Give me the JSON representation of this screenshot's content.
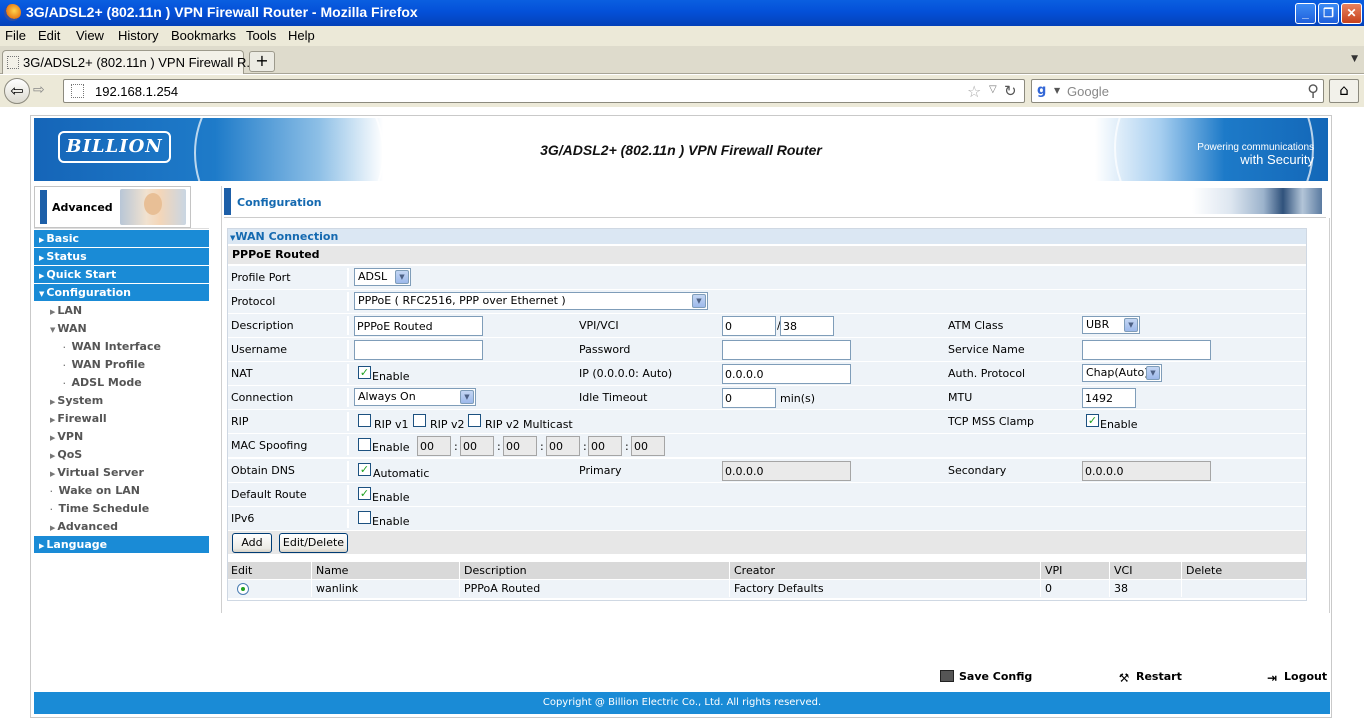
{
  "window": {
    "title": "3G/ADSL2+ (802.11n ) VPN Firewall Router - Mozilla Firefox"
  },
  "menu": [
    "File",
    "Edit",
    "View",
    "History",
    "Bookmarks",
    "Tools",
    "Help"
  ],
  "tab": {
    "label": "3G/ADSL2+ (802.11n ) VPN Firewall R..."
  },
  "nav": {
    "url": "192.168.1.254",
    "search_placeholder": "Google"
  },
  "banner": {
    "logo": "BILLION",
    "title": "3G/ADSL2+ (802.11n ) VPN Firewall Router",
    "slogan_line1": "Powering communications",
    "slogan_line2": "with Security"
  },
  "sidebar": {
    "mode": "Advanced",
    "items": [
      "Basic",
      "Status",
      "Quick Start",
      "Configuration",
      "LAN",
      "WAN",
      "WAN Interface",
      "WAN Profile",
      "ADSL Mode",
      "System",
      "Firewall",
      "VPN",
      "QoS",
      "Virtual Server",
      "Wake on LAN",
      "Time Schedule",
      "Advanced",
      "Language"
    ]
  },
  "content": {
    "header": "Configuration",
    "section": "WAN Connection",
    "subsection": "PPPoE Routed",
    "labels": {
      "profile_port": "Profile Port",
      "protocol": "Protocol",
      "description": "Description",
      "vpi_vci": "VPI/VCI",
      "atm_class": "ATM Class",
      "username": "Username",
      "password": "Password",
      "service_name": "Service Name",
      "nat": "NAT",
      "ip": "IP (0.0.0.0: Auto)",
      "auth_protocol": "Auth. Protocol",
      "connection": "Connection",
      "idle_timeout": "Idle Timeout",
      "mtu": "MTU",
      "rip": "RIP",
      "tcp_mss_clamp": "TCP MSS Clamp",
      "mac_spoofing": "MAC Spoofing",
      "obtain_dns": "Obtain DNS",
      "primary": "Primary",
      "secondary": "Secondary",
      "default_route": "Default Route",
      "ipv6": "IPv6",
      "min_s": "min(s)",
      "enable": "Enable",
      "automatic": "Automatic",
      "rip_v1": "RIP v1",
      "rip_v2": "RIP v2",
      "rip_v2_multicast": "RIP v2 Multicast"
    },
    "values": {
      "profile_port": "ADSL",
      "protocol": "PPPoE ( RFC2516, PPP over Ethernet )",
      "description": "PPPoE Routed",
      "vpi": "0",
      "vci": "38",
      "atm_class": "UBR",
      "username": "",
      "password": "",
      "service_name": "",
      "ip": "0.0.0.0",
      "auth_protocol": "Chap(Auto)",
      "connection": "Always On",
      "idle_timeout": "0",
      "mtu": "1492",
      "mac": [
        "00",
        "00",
        "00",
        "00",
        "00",
        "00"
      ],
      "primary_dns": "0.0.0.0",
      "secondary_dns": "0.0.0.0",
      "nat_enabled": true,
      "tcp_mss_enabled": true,
      "mac_spoof_enabled": false,
      "dns_auto": true,
      "default_route_enabled": true,
      "ipv6_enabled": false,
      "rip_v1": false,
      "rip_v2": false,
      "rip_v2_multicast": false
    },
    "buttons": {
      "add": "Add",
      "edit_delete": "Edit/Delete"
    },
    "table": {
      "headers": [
        "Edit",
        "Name",
        "Description",
        "Creator",
        "VPI",
        "VCI",
        "Delete"
      ],
      "rows": [
        {
          "name": "wanlink",
          "description": "PPPoA Routed",
          "creator": "Factory Defaults",
          "vpi": "0",
          "vci": "38",
          "delete": ""
        }
      ]
    }
  },
  "footer": {
    "save": "Save Config",
    "restart": "Restart",
    "logout": "Logout",
    "copyright": "Copyright @ Billion Electric Co., Ltd. All rights reserved."
  }
}
